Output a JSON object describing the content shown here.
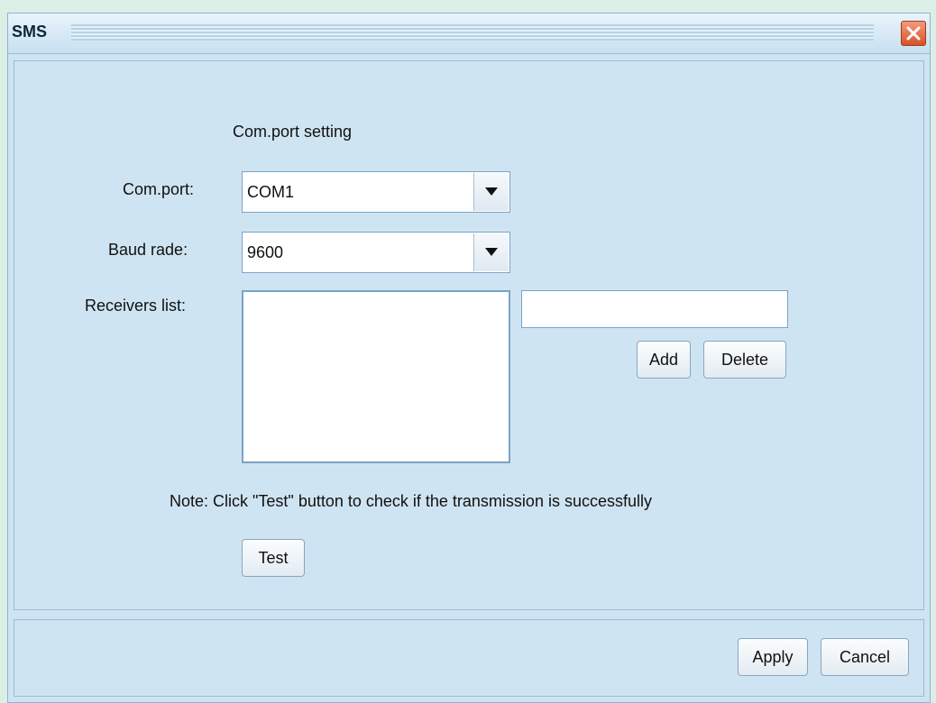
{
  "window": {
    "title": "SMS"
  },
  "section": {
    "title": "Com.port setting"
  },
  "com_port": {
    "label": "Com.port:",
    "value": "COM1"
  },
  "baud_rate": {
    "label": "Baud rade:",
    "value": "9600"
  },
  "receivers": {
    "label": "Receivers list:",
    "input_value": ""
  },
  "buttons": {
    "add": "Add",
    "delete": "Delete",
    "test": "Test",
    "apply": "Apply",
    "cancel": "Cancel"
  },
  "note": "Note:  Click \"Test\" button to check if the transmission is successfully",
  "icons": {
    "close": "close-icon",
    "dropdown": "chevron-down-icon"
  },
  "colors": {
    "background": "#cfe4f2",
    "close_button": "#d8512c"
  }
}
